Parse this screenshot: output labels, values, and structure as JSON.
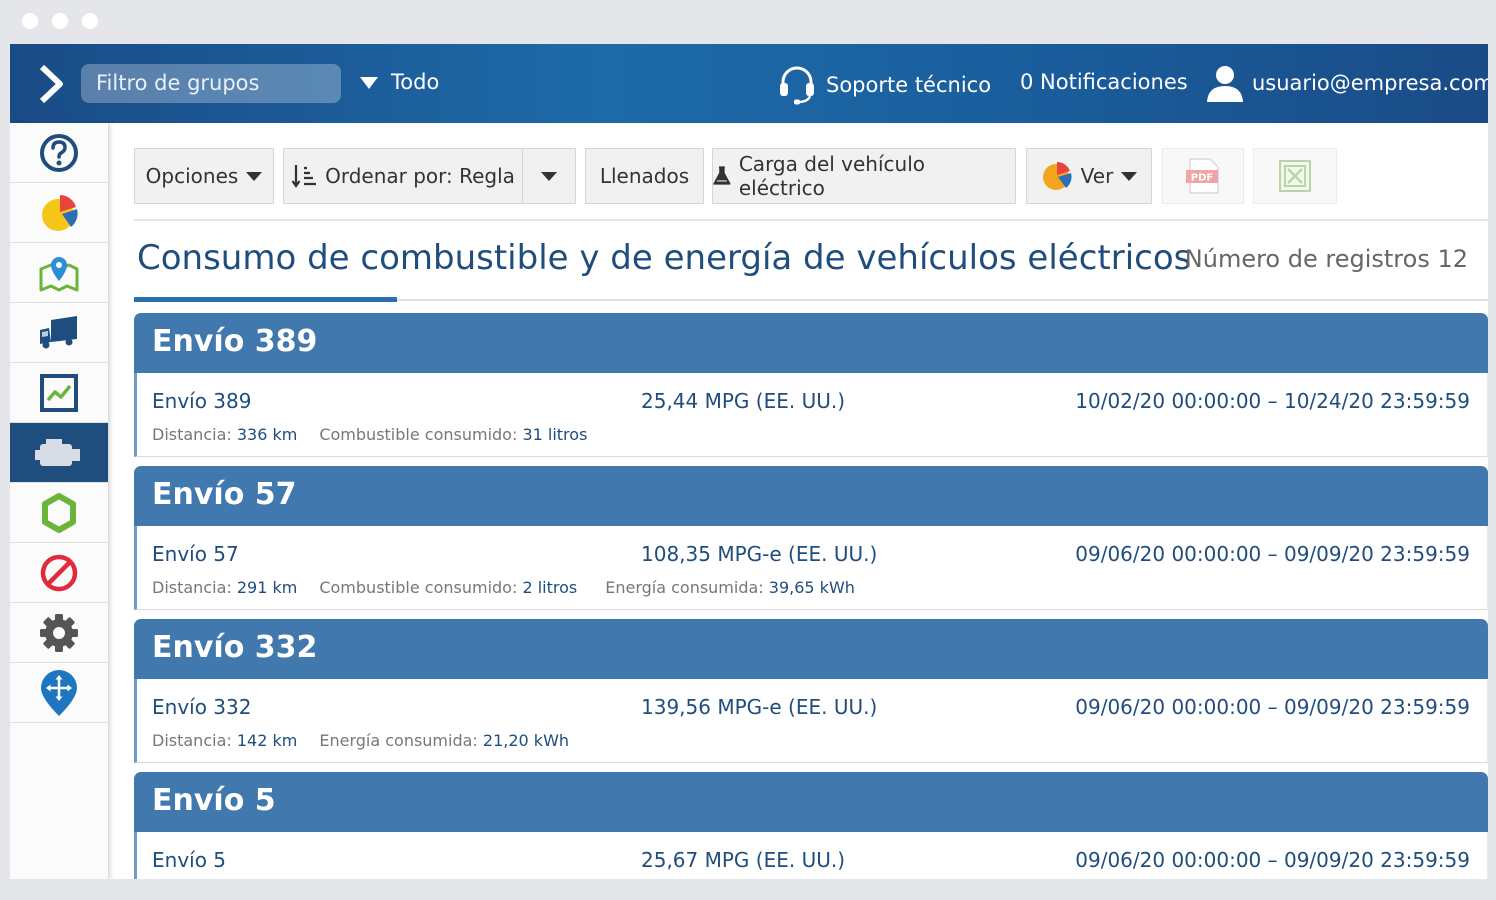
{
  "topbar": {
    "group_filter_placeholder": "Filtro de grupos",
    "group_scope": "Todo",
    "support": "Soporte técnico",
    "notifications": "0 Notificaciones",
    "user_email": "usuario@empresa.com"
  },
  "sidebar": {
    "items": [
      {
        "icon": "help-icon"
      },
      {
        "icon": "pie-chart-icon"
      },
      {
        "icon": "map-pin-icon"
      },
      {
        "icon": "truck-icon"
      },
      {
        "icon": "trend-chart-icon"
      },
      {
        "icon": "engine-icon",
        "active": true
      },
      {
        "icon": "rules-icon"
      },
      {
        "icon": "no-entry-icon"
      },
      {
        "icon": "gear-icon"
      },
      {
        "icon": "navigation-pin-icon"
      }
    ]
  },
  "toolbar": {
    "options": "Opciones",
    "sort": "Ordenar por: Regla",
    "fillups": "Llenados",
    "ev_charge": "Carga del vehículo eléctrico",
    "view": "Ver",
    "pdf": "PDF"
  },
  "page": {
    "title": "Consumo de combustible y de energía de vehículos eléctricos",
    "record_count": "Número de registros 12"
  },
  "labels": {
    "distance": "Distancia:",
    "fuel": "Combustible consumido:",
    "energy": "Energía consumida:"
  },
  "records": [
    {
      "header": "Envío 389",
      "name": "Envío 389",
      "efficiency": "25,44 MPG (EE. UU.)",
      "period": "10/02/20 00:00:00 – 10/24/20 23:59:59",
      "distance": "336 km",
      "fuel": "31 litros",
      "energy": ""
    },
    {
      "header": "Envío 57",
      "name": "Envío 57",
      "efficiency": "108,35 MPG-e (EE. UU.)",
      "period": "09/06/20 00:00:00 – 09/09/20 23:59:59",
      "distance": "291 km",
      "fuel": "2 litros",
      "energy": "39,65 kWh"
    },
    {
      "header": "Envío 332",
      "name": "Envío 332",
      "efficiency": "139,56 MPG-e (EE. UU.)",
      "period": "09/06/20 00:00:00 – 09/09/20 23:59:59",
      "distance": "142 km",
      "fuel": "",
      "energy": "21,20 kWh"
    },
    {
      "header": "Envío 5",
      "name": "Envío 5",
      "efficiency": "25,67 MPG (EE. UU.)",
      "period": "09/06/20 00:00:00 – 09/09/20 23:59:59",
      "distance": "",
      "fuel": "",
      "energy": ""
    }
  ],
  "colors": {
    "header_blue": "#4178ad",
    "nav_dark": "#1f4d7e",
    "text_blue": "#1f4d7e"
  }
}
